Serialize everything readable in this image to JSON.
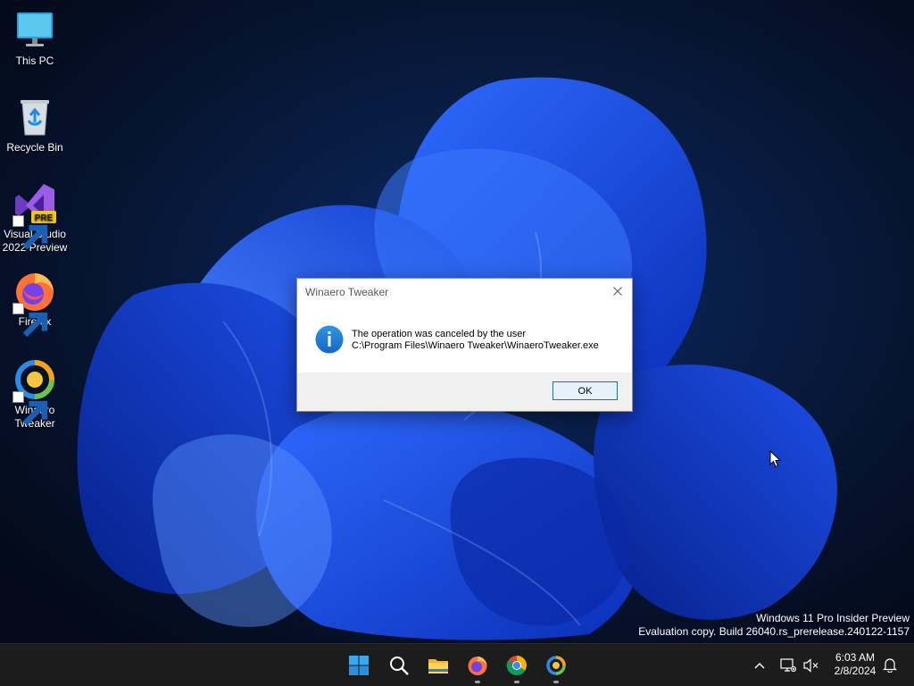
{
  "desktop": {
    "icons": [
      {
        "label": "This PC",
        "icon": "monitor-icon"
      },
      {
        "label": "Recycle Bin",
        "icon": "recycle-bin-icon"
      },
      {
        "label": "Visual Studio 2022 Preview",
        "line1": "Visual Studio",
        "line2": "2022 Preview",
        "badge": "PRE",
        "icon": "visual-studio-icon"
      },
      {
        "label": "Firefox",
        "icon": "firefox-icon"
      },
      {
        "label": "Winaero Tweaker",
        "line1": "Winaero",
        "line2": "Tweaker",
        "icon": "winaero-tweaker-icon"
      }
    ]
  },
  "dialog": {
    "title": "Winaero Tweaker",
    "message_line1": "The operation was canceled by the user",
    "message_line2": "C:\\Program Files\\Winaero Tweaker\\WinaeroTweaker.exe",
    "ok_label": "OK",
    "icon": "info-icon"
  },
  "watermark": {
    "line1": "Windows 11 Pro Insider Preview",
    "line2": "Evaluation copy. Build 26040.rs_prerelease.240122-1157"
  },
  "taskbar": {
    "apps": [
      "start-icon",
      "search-icon",
      "file-explorer-icon",
      "firefox-icon",
      "chrome-icon",
      "winaero-tweaker-icon"
    ],
    "clock_time": "6:03 AM",
    "clock_date": "2/8/2024"
  },
  "colors": {
    "accent": "#0078d4",
    "taskbar": "#1c1c1c",
    "wallpaper_bg": "#040b1e"
  }
}
